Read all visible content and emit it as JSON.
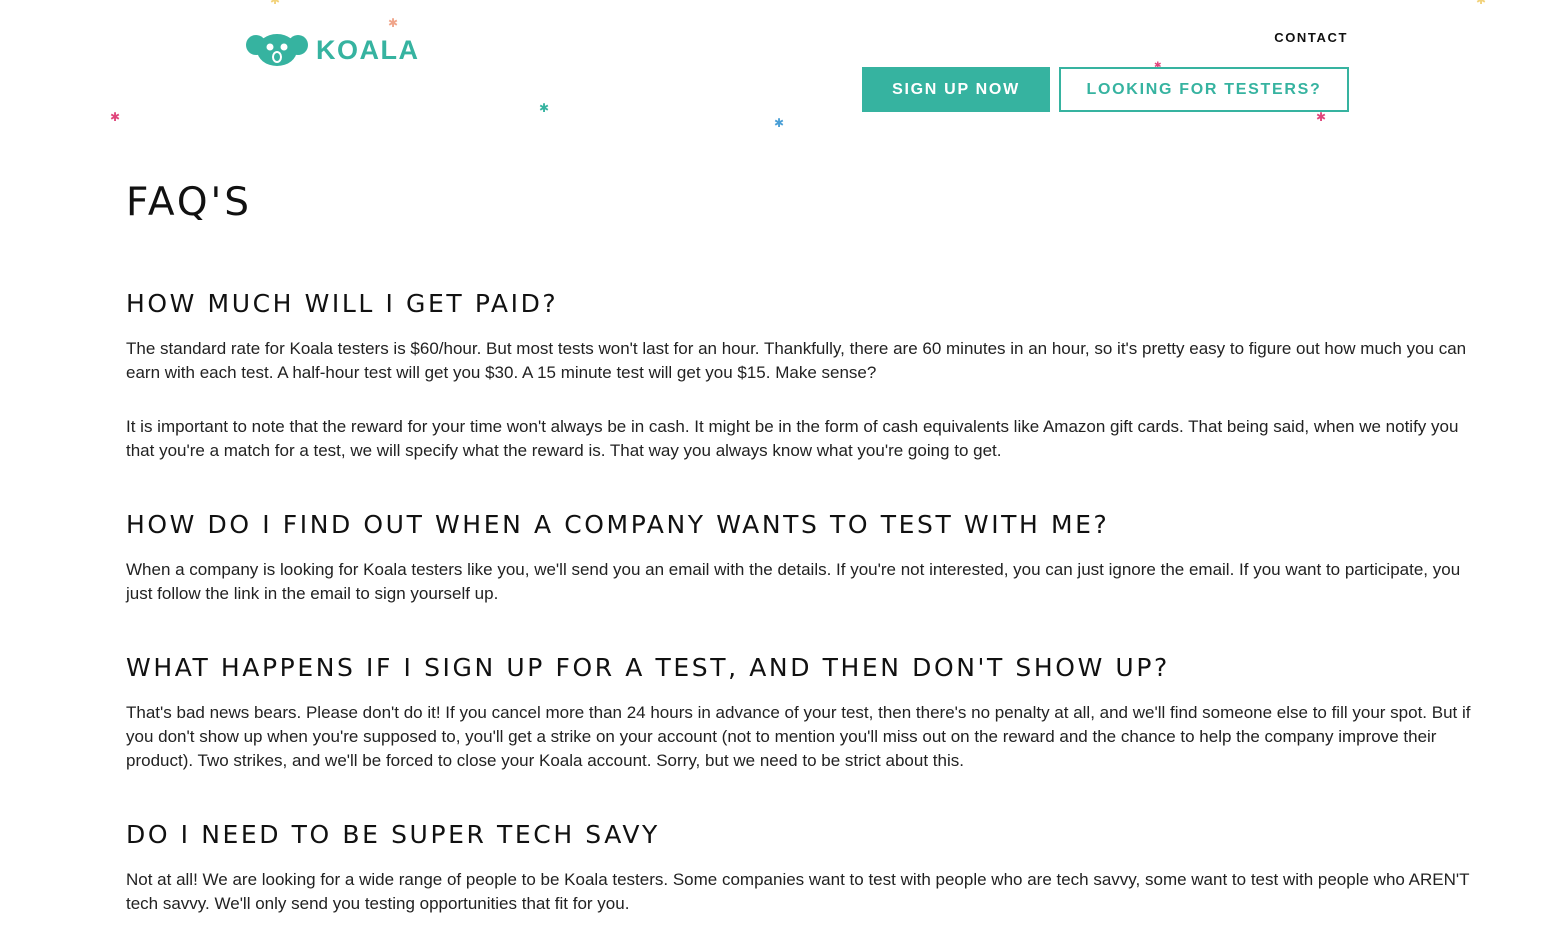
{
  "header": {
    "logo_text": "KOALA",
    "contact_label": "CONTACT",
    "signup_label": "SIGN UP NOW",
    "testers_label": "LOOKING FOR TESTERS?"
  },
  "colors": {
    "brand": "#36b3a0",
    "accent_pink": "#e0457b",
    "accent_blue": "#4a9fd6",
    "accent_yellow": "#f2d27a"
  },
  "page": {
    "title": "FAQ'S"
  },
  "faq": [
    {
      "question": "HOW MUCH WILL I GET PAID?",
      "paragraphs": [
        "The standard rate for Koala testers is $60/hour. But most tests won't last for an hour. Thankfully, there are 60 minutes in an hour, so it's pretty easy to figure out how much you can earn with each test. A half-hour test will get you $30. A 15 minute test will get you $15. Make sense?",
        "It is important to note that the reward for your time won't always be in cash. It might be in the form of cash equivalents like Amazon gift cards. That being said, when we notify you that you're a match for a test, we will specify what the reward is. That way you always know what you're going to get."
      ]
    },
    {
      "question": "HOW DO I FIND OUT WHEN A COMPANY WANTS TO TEST WITH ME?",
      "paragraphs": [
        "When a company is looking for Koala testers like you, we'll send you an email with the details. If you're not interested, you can just ignore the email. If you want to participate, you just follow the link in the email to sign yourself up."
      ]
    },
    {
      "question": "WHAT HAPPENS IF I SIGN UP FOR A TEST, AND THEN DON'T SHOW UP?",
      "paragraphs": [
        "That's bad news bears. Please don't do it! If you cancel more than 24 hours in advance of your test, then there's no penalty at all, and we'll find someone else to fill your spot. But if you don't show up when you're supposed to, you'll get a strike on your account (not to mention you'll miss out on the reward and the chance to help the company improve their product). Two strikes, and we'll be forced to close your Koala account. Sorry, but we need to be strict about this."
      ]
    },
    {
      "question": "DO I NEED TO BE SUPER TECH SAVY",
      "paragraphs": [
        "Not at all! We are looking for a wide range of people to be Koala testers. Some companies want to test with people who are tech savvy, some want to test with people who AREN'T tech savvy. We'll only send you testing opportunities that fit for you."
      ]
    }
  ]
}
